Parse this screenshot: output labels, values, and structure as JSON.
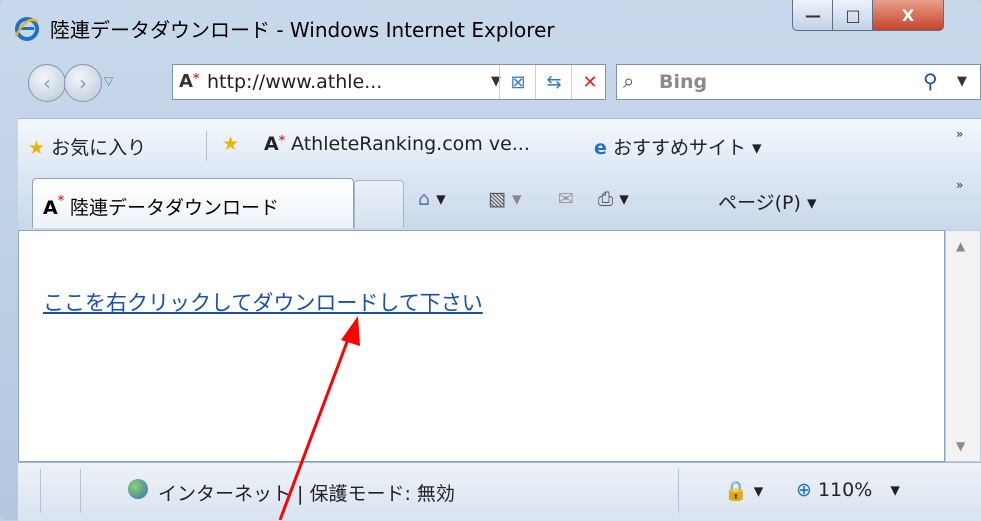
{
  "window": {
    "title": "陸連データダウンロード - Windows Internet Explorer",
    "buttons": {
      "minimize": "—",
      "maximize": "□",
      "close": "X"
    }
  },
  "nav": {
    "back_icon": "back-arrow-icon",
    "forward_icon": "forward-arrow-icon",
    "address": "http://www.athle...",
    "search_placeholder": "Bing"
  },
  "favorites": {
    "favorites_label": "お気に入り",
    "athlete_link": "AthleteRanking.com ve...",
    "suggested_sites": "おすすめサイト ▾"
  },
  "tab": {
    "label": "陸連データダウンロード"
  },
  "command_bar": {
    "page_menu": "ページ(P) ▾"
  },
  "content": {
    "download_link": "ここを右クリックしてダウンロードして下さい"
  },
  "status": {
    "zone_text": "インターネット | 保護モード: 無効",
    "zoom": "110%"
  },
  "colors": {
    "link": "#1a4fb0",
    "arrow": "#ff0000",
    "close_button": "#c7432a"
  }
}
